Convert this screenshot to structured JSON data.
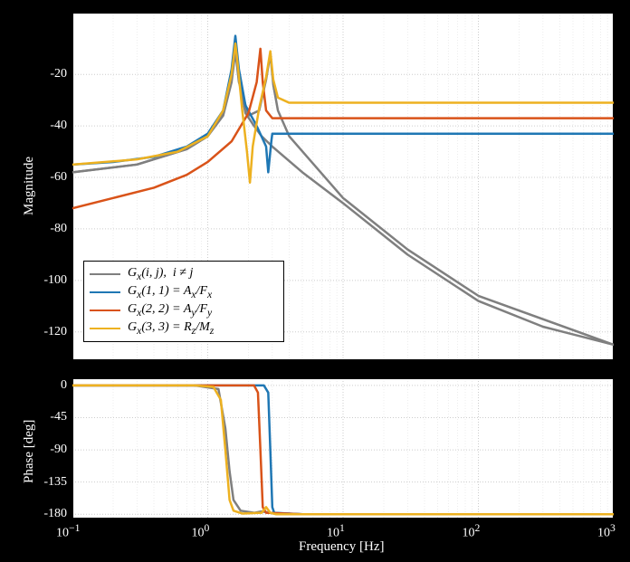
{
  "chart_data": [
    {
      "type": "line",
      "title": "Magnitude",
      "xscale": "log",
      "xlim": [
        0.1,
        1000
      ],
      "ylabel": "Magnitude",
      "yticks": [
        -120,
        -100,
        -80,
        -60,
        -40,
        -20
      ],
      "ylim": [
        -131,
        4
      ],
      "series": [
        {
          "name": "G_x(i,j),  i ≠ j",
          "color": "#7f7f7f",
          "key": "gray"
        },
        {
          "name": "G_x(1,1) = A_x/F_x",
          "color": "#1f77b4",
          "key": "blue"
        },
        {
          "name": "G_x(2,2) = A_y/F_y",
          "color": "#d95319",
          "key": "red"
        },
        {
          "name": "G_x(3,3) = R_z/M_z",
          "color": "#edb120",
          "key": "yellow"
        }
      ],
      "resonances": {
        "blue": 1.6,
        "red": 2.45,
        "yellow": 2.9,
        "yellow_dip": 2.05
      },
      "plateaus_high": {
        "blue": -43,
        "red": -37,
        "yellow": -31,
        "gray": -125
      }
    },
    {
      "type": "line",
      "title": "Phase",
      "xscale": "log",
      "xlim": [
        0.1,
        1000
      ],
      "ylabel": "Phase [deg]",
      "yticks": [
        -180,
        -135,
        -90,
        -45,
        0
      ],
      "ylim": [
        -186,
        10
      ],
      "xlabel": "Frequency [Hz]",
      "xticks_labels": [
        "10^{-1}",
        "10^{0}",
        "10^{1}",
        "10^{2}",
        "10^{3}"
      ],
      "xticks_values": [
        0.1,
        1,
        10,
        100,
        1000
      ],
      "series_ref": "same_colors_as_top",
      "transitions": {
        "yellow": 1.3,
        "red": 2.4,
        "blue": 2.9
      }
    }
  ],
  "legend": {
    "items": [
      {
        "label_html": "G<sub>x</sub>(i, j),&nbsp;&nbsp;i ≠ j",
        "color": "#7f7f7f"
      },
      {
        "label_html": "G<sub>x</sub>(1, 1) = A<sub>x</sub>/F<sub>x</sub>",
        "color": "#1f77b4"
      },
      {
        "label_html": "G<sub>x</sub>(2, 2) = A<sub>y</sub>/F<sub>y</sub>",
        "color": "#d95319"
      },
      {
        "label_html": "G<sub>x</sub>(3, 3) = R<sub>z</sub>/M<sub>z</sub>",
        "color": "#edb120"
      }
    ]
  },
  "curves_top": {
    "blue": [
      [
        0.1,
        -55
      ],
      [
        0.2,
        -54
      ],
      [
        0.4,
        -52
      ],
      [
        0.7,
        -48
      ],
      [
        1.0,
        -43
      ],
      [
        1.3,
        -34
      ],
      [
        1.5,
        -18
      ],
      [
        1.6,
        -5
      ],
      [
        1.7,
        -18
      ],
      [
        1.9,
        -32
      ],
      [
        2.3,
        -40
      ],
      [
        2.7,
        -48
      ],
      [
        2.8,
        -58
      ],
      [
        2.95,
        -46
      ],
      [
        3.0,
        -43
      ],
      [
        3.3,
        -43
      ],
      [
        5,
        -43
      ],
      [
        10,
        -43
      ],
      [
        100,
        -43
      ],
      [
        1000,
        -43
      ]
    ],
    "red": [
      [
        0.1,
        -72
      ],
      [
        0.2,
        -68
      ],
      [
        0.4,
        -64
      ],
      [
        0.7,
        -59
      ],
      [
        1.0,
        -54
      ],
      [
        1.5,
        -46
      ],
      [
        2.0,
        -35
      ],
      [
        2.3,
        -23
      ],
      [
        2.45,
        -10
      ],
      [
        2.55,
        -23
      ],
      [
        2.7,
        -34
      ],
      [
        3.0,
        -37
      ],
      [
        5,
        -37
      ],
      [
        10,
        -37
      ],
      [
        100,
        -37
      ],
      [
        1000,
        -37
      ]
    ],
    "yellow": [
      [
        0.1,
        -55
      ],
      [
        0.3,
        -53
      ],
      [
        0.6,
        -50
      ],
      [
        1.0,
        -44
      ],
      [
        1.3,
        -34
      ],
      [
        1.5,
        -20
      ],
      [
        1.6,
        -8
      ],
      [
        1.65,
        -14
      ],
      [
        1.8,
        -34
      ],
      [
        1.95,
        -50
      ],
      [
        2.05,
        -62
      ],
      [
        2.15,
        -48
      ],
      [
        2.4,
        -33
      ],
      [
        2.7,
        -21
      ],
      [
        2.9,
        -11
      ],
      [
        3.05,
        -22
      ],
      [
        3.3,
        -29
      ],
      [
        4,
        -31
      ],
      [
        10,
        -31
      ],
      [
        100,
        -31
      ],
      [
        1000,
        -31
      ]
    ],
    "gray": [
      [
        0.1,
        -58
      ],
      [
        0.3,
        -55
      ],
      [
        0.7,
        -49
      ],
      [
        1.0,
        -44
      ],
      [
        1.3,
        -35
      ],
      [
        1.5,
        -22
      ],
      [
        1.6,
        -9
      ],
      [
        1.7,
        -22
      ],
      [
        1.9,
        -35
      ],
      [
        2.2,
        -40
      ],
      [
        2.5,
        -44
      ],
      [
        3.0,
        -48
      ],
      [
        5,
        -58
      ],
      [
        10,
        -70
      ],
      [
        30,
        -90
      ],
      [
        100,
        -108
      ],
      [
        300,
        -118
      ],
      [
        1000,
        -125
      ]
    ],
    "gray2": [
      [
        0.1,
        -58
      ],
      [
        0.3,
        -55
      ],
      [
        0.7,
        -49
      ],
      [
        1.0,
        -44
      ],
      [
        1.3,
        -36
      ],
      [
        1.5,
        -23
      ],
      [
        1.6,
        -11
      ],
      [
        1.7,
        -23
      ],
      [
        2.0,
        -36
      ],
      [
        2.4,
        -34
      ],
      [
        2.7,
        -22
      ],
      [
        2.9,
        -12
      ],
      [
        3.05,
        -24
      ],
      [
        3.3,
        -34
      ],
      [
        4,
        -44
      ],
      [
        10,
        -68
      ],
      [
        30,
        -88
      ],
      [
        100,
        -106
      ],
      [
        1000,
        -125
      ]
    ]
  },
  "curves_bottom": {
    "blue": [
      [
        0.1,
        0
      ],
      [
        1.0,
        0
      ],
      [
        2.6,
        0
      ],
      [
        2.8,
        -10
      ],
      [
        2.9,
        -90
      ],
      [
        3.0,
        -170
      ],
      [
        3.1,
        -178
      ],
      [
        5,
        -180
      ],
      [
        1000,
        -180
      ]
    ],
    "red": [
      [
        0.1,
        0
      ],
      [
        1.0,
        0
      ],
      [
        2.2,
        0
      ],
      [
        2.35,
        -10
      ],
      [
        2.45,
        -90
      ],
      [
        2.55,
        -170
      ],
      [
        2.7,
        -178
      ],
      [
        5,
        -180
      ],
      [
        1000,
        -180
      ]
    ],
    "yellow": [
      [
        0.1,
        0
      ],
      [
        0.8,
        0
      ],
      [
        1.1,
        -2
      ],
      [
        1.25,
        -20
      ],
      [
        1.35,
        -90
      ],
      [
        1.45,
        -160
      ],
      [
        1.55,
        -175
      ],
      [
        1.8,
        -179
      ],
      [
        2.5,
        -178
      ],
      [
        2.7,
        -170
      ],
      [
        2.9,
        -178
      ],
      [
        3.2,
        -180
      ],
      [
        1000,
        -180
      ]
    ],
    "gray": [
      [
        0.1,
        0
      ],
      [
        0.8,
        0
      ],
      [
        1.2,
        -5
      ],
      [
        1.35,
        -60
      ],
      [
        1.45,
        -120
      ],
      [
        1.55,
        -160
      ],
      [
        1.75,
        -175
      ],
      [
        2.2,
        -178
      ],
      [
        2.5,
        -176
      ],
      [
        2.9,
        -178
      ],
      [
        5,
        -180
      ],
      [
        1000,
        -180
      ]
    ]
  },
  "xticks": [
    0.1,
    1,
    10,
    100,
    1000
  ],
  "xticklabels_html": [
    "10<sup>−1</sup>",
    "10<sup>0</sup>",
    "10<sup>1</sup>",
    "10<sup>2</sup>",
    "10<sup>3</sup>"
  ]
}
